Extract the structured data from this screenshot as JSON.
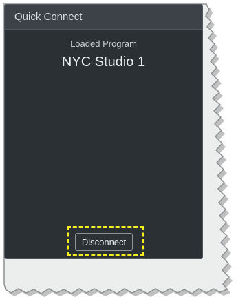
{
  "panel": {
    "title": "Quick Connect"
  },
  "program": {
    "label": "Loaded Program",
    "name": "NYC Studio 1"
  },
  "actions": {
    "disconnect_label": "Disconnect"
  },
  "colors": {
    "panel_background": "#2b3034",
    "header_background": "#3c4247",
    "highlight": "#f5ef1e"
  }
}
